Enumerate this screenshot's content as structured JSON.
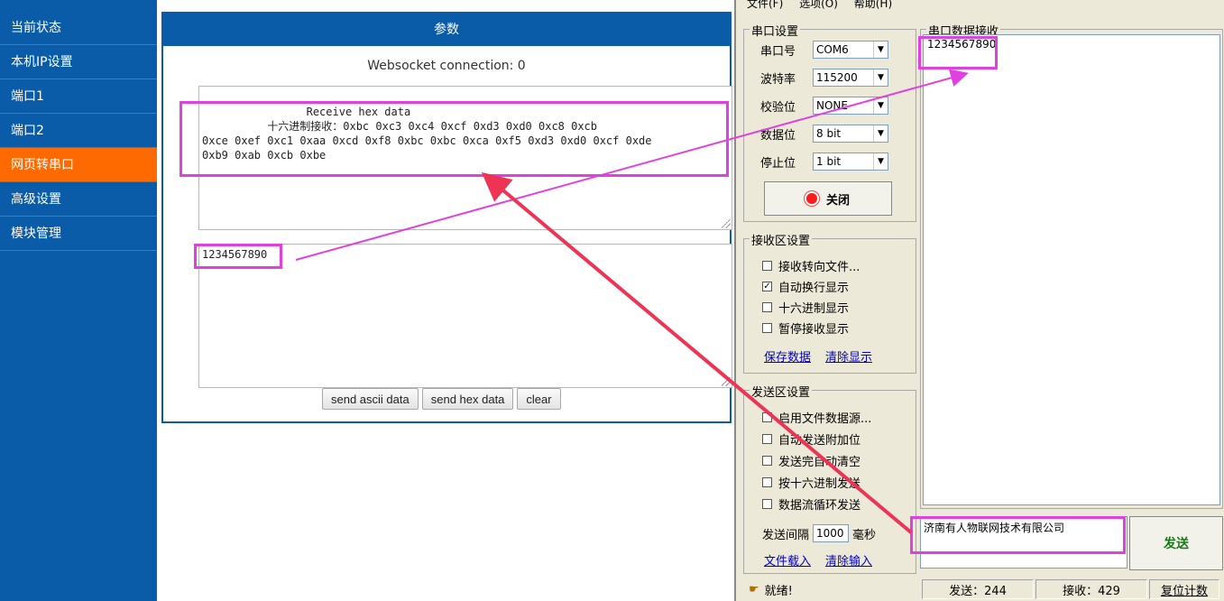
{
  "web": {
    "sidebar": {
      "items": [
        {
          "label": "当前状态"
        },
        {
          "label": "本机IP设置"
        },
        {
          "label": "端口1"
        },
        {
          "label": "端口2"
        },
        {
          "label": "网页转串口"
        },
        {
          "label": "高级设置"
        },
        {
          "label": "模块管理"
        }
      ],
      "active_index": 4
    },
    "panel_title": "参数",
    "ws_status": "Websocket connection: 0",
    "receive_text": "          Receive hex data\n          十六进制接收：0xbc 0xc3 0xc4 0xcf 0xd3 0xd0 0xc8 0xcb\n0xce 0xef 0xc1 0xaa 0xcd 0xf8 0xbc 0xbc 0xca 0xf5 0xd3 0xd0 0xcf 0xde\n0xb9 0xab 0xcb 0xbe",
    "send_text": "1234567890",
    "buttons": {
      "send_ascii": "send ascii data",
      "send_hex": "send hex data",
      "clear": "clear"
    },
    "colors": {
      "sidebar": "#0b5ca8",
      "active": "#ff6a00"
    }
  },
  "tool": {
    "menu": [
      "文件(F)",
      "选项(O)",
      "帮助(H)"
    ],
    "serial_settings": {
      "title": "串口设置",
      "port_label": "串口号",
      "port_value": "COM6",
      "baud_label": "波特率",
      "baud_value": "115200",
      "parity_label": "校验位",
      "parity_value": "NONE",
      "data_bits_label": "数据位",
      "data_bits_value": "8 bit",
      "stop_bits_label": "停止位",
      "stop_bits_value": "1 bit",
      "close_button": "关闭"
    },
    "recv_settings": {
      "title": "接收区设置",
      "options": [
        {
          "label": "接收转向文件...",
          "checked": false
        },
        {
          "label": "自动换行显示",
          "checked": true
        },
        {
          "label": "十六进制显示",
          "checked": false
        },
        {
          "label": "暂停接收显示",
          "checked": false
        }
      ],
      "save_link": "保存数据",
      "clear_link": "清除显示"
    },
    "send_settings": {
      "title": "发送区设置",
      "options": [
        {
          "label": "启用文件数据源...",
          "checked": false
        },
        {
          "label": "自动发送附加位",
          "checked": false
        },
        {
          "label": "发送完自动清空",
          "checked": false
        },
        {
          "label": "按十六进制发送",
          "checked": false
        },
        {
          "label": "数据流循环发送",
          "checked": false
        }
      ],
      "interval_label": "发送间隔",
      "interval_value": "1000",
      "interval_unit": "毫秒",
      "load_link": "文件载入",
      "clear_input_link": "清除输入"
    },
    "recv_area": {
      "title": "串口数据接收",
      "text": "1234567890"
    },
    "send_area": {
      "text": "济南有人物联网技术有限公司"
    },
    "send_button": "发送",
    "status": {
      "ready": "就绪!",
      "sent": "发送：244",
      "received": "接收：429",
      "reset": "复位计数"
    }
  }
}
